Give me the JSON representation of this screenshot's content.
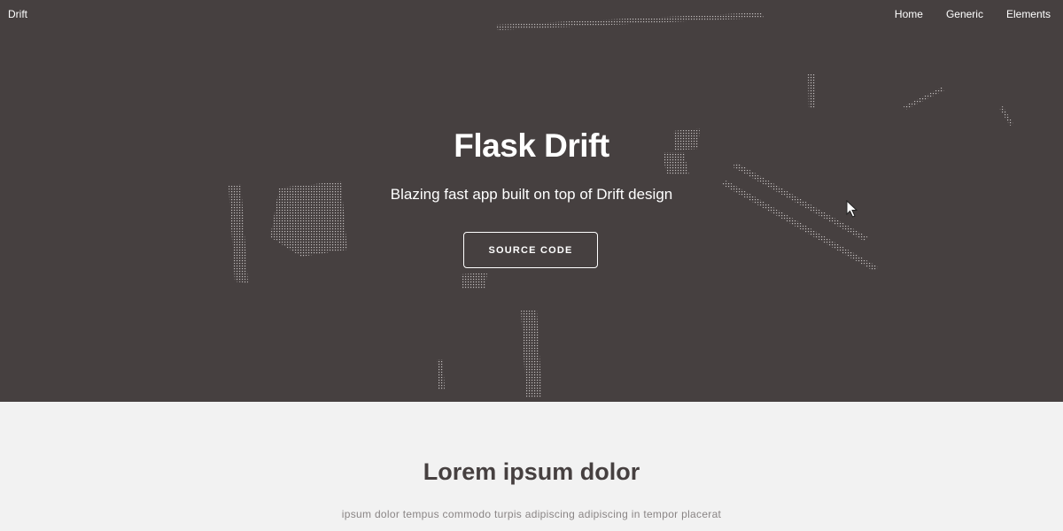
{
  "brand": "Drift",
  "nav": {
    "items": [
      "Home",
      "Generic",
      "Elements"
    ]
  },
  "hero": {
    "title": "Flask Drift",
    "subtitle": "Blazing fast app built on top of Drift design",
    "button_label": "SOURCE CODE"
  },
  "section": {
    "title": "Lorem ipsum dolor",
    "text": "ipsum dolor tempus commodo turpis adipiscing adipiscing in tempor placerat"
  },
  "colors": {
    "hero_bg": "#464040",
    "section_bg": "#f2f2f2",
    "text_light": "#ffffff",
    "heading_dark": "#464040"
  }
}
